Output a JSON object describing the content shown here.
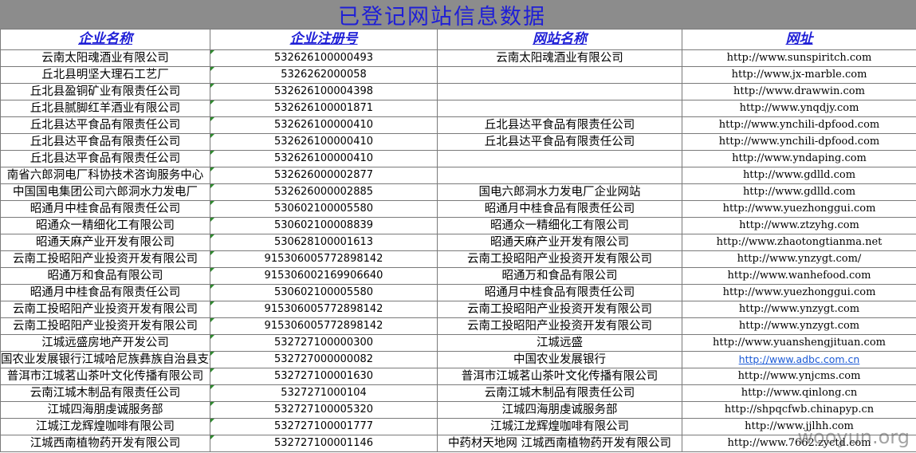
{
  "title": "已登记网站信息数据",
  "headers": [
    "企业名称",
    "企业注册号",
    "网站名称",
    "网址"
  ],
  "rows": [
    {
      "company": "云南太阳魂酒业有限公司",
      "reg": "532626100000493",
      "site": "云南太阳魂酒业有限公司",
      "url": "http://www.sunspiritch.com"
    },
    {
      "company": "丘北县明坚大理石工艺厂",
      "reg": "5326262000058",
      "site": "",
      "url": "http://www.jx-marble.com"
    },
    {
      "company": "丘北县盈铜矿业有限责任公司",
      "reg": "532626100004398",
      "site": "",
      "url": "http://www.drawwin.com"
    },
    {
      "company": "丘北县腻脚红羊酒业有限公司",
      "reg": "532626100001871",
      "site": "",
      "url": "http://www.ynqdjy.com"
    },
    {
      "company": "丘北县达平食品有限责任公司",
      "reg": "532626100000410",
      "site": "丘北县达平食品有限责任公司",
      "url": "http://www.ynchili-dpfood.com"
    },
    {
      "company": "丘北县达平食品有限责任公司",
      "reg": "532626100000410",
      "site": "丘北县达平食品有限责任公司",
      "url": "http://www.ynchili-dpfood.com"
    },
    {
      "company": "丘北县达平食品有限责任公司",
      "reg": "532626100000410",
      "site": "",
      "url": "http://www.yndaping.com"
    },
    {
      "company": "南省六郎洞电厂科协技术咨询服务中心",
      "reg": "532626000002877",
      "site": "",
      "url": "http://www.gdlld.com"
    },
    {
      "company": "中国国电集团公司六郎洞水力发电厂",
      "reg": "532626000002885",
      "site": "国电六郎洞水力发电厂企业网站",
      "url": "http://www.gdlld.com"
    },
    {
      "company": "昭通月中桂食品有限责任公司",
      "reg": "530602100005580",
      "site": "昭通月中桂食品有限责任公司",
      "url": "http://www.yuezhonggui.com"
    },
    {
      "company": "昭通众一精细化工有限公司",
      "reg": "530602100008839",
      "site": "昭通众一精细化工有限公司",
      "url": "http://www.ztzyhg.com"
    },
    {
      "company": "昭通天麻产业开发有限公司",
      "reg": "530628100001613",
      "site": "昭通天麻产业开发有限公司",
      "url": "http://www.zhaotongtianma.net"
    },
    {
      "company": "云南工投昭阳产业投资开发有限公司",
      "reg": "915306005772898142",
      "site": "云南工投昭阳产业投资开发有限公司",
      "url": "http://www.ynzygt.com/"
    },
    {
      "company": "昭通万和食品有限公司",
      "reg": "915306002169906640",
      "site": "昭通万和食品有限公司",
      "url": "http://www.wanhefood.com"
    },
    {
      "company": "昭通月中桂食品有限责任公司",
      "reg": "530602100005580",
      "site": "昭通月中桂食品有限责任公司",
      "url": "http://www.yuezhonggui.com"
    },
    {
      "company": "云南工投昭阳产业投资开发有限公司",
      "reg": "915306005772898142",
      "site": "云南工投昭阳产业投资开发有限公司",
      "url": "http://www.ynzygt.com"
    },
    {
      "company": "云南工投昭阳产业投资开发有限公司",
      "reg": "915306005772898142",
      "site": "云南工投昭阳产业投资开发有限公司",
      "url": "http://www.ynzygt.com"
    },
    {
      "company": "江城远盛房地产开发公司",
      "reg": "532727100000300",
      "site": "江城远盛",
      "url": "http://www.yuanshengjituan.com"
    },
    {
      "company": "国农业发展银行江城哈尼族彝族自治县支行",
      "reg": "532727000000082",
      "site": "中国农业发展银行",
      "url": "http://www.adbc.com.cn",
      "link": true
    },
    {
      "company": "普洱市江城茗山茶叶文化传播有限公司",
      "reg": "532727100001630",
      "site": "普洱市江城茗山茶叶文化传播有限公司",
      "url": "http://www.ynjcms.com"
    },
    {
      "company": "云南江城木制品有限责任公司",
      "reg": "5327271000104",
      "site": "云南江城木制品有限责任公司",
      "url": "http://www.qinlong.cn"
    },
    {
      "company": "江城四海朋虔诚服务部",
      "reg": "532727100005320",
      "site": "江城四海朋虔诚服务部",
      "url": "http://shpqcfwb.chinapyp.cn"
    },
    {
      "company": "江城江龙辉煌咖啡有限公司",
      "reg": "532727100001777",
      "site": "江城江龙辉煌咖啡有限公司",
      "url": "http://www.jjlhh.com"
    },
    {
      "company": "江城西南植物药开发有限公司",
      "reg": "532727100001146",
      "site": "中药材天地网 江城西南植物药开发有限公司",
      "url": "http://www.7662.zyctd.com"
    }
  ],
  "watermark": "wooyun.org",
  "colors": {
    "title_bg": "#8c8c8c",
    "title_text": "#1f1fd6",
    "link": "#1b5ad6",
    "marker": "#2e8b2e"
  }
}
